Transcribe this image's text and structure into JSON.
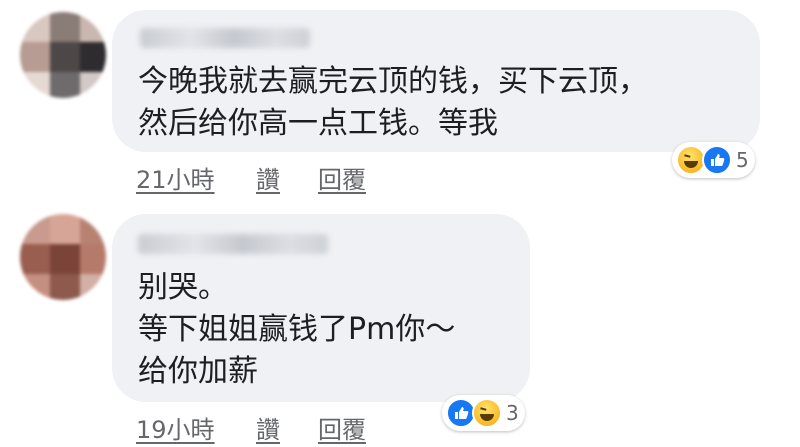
{
  "comments": [
    {
      "lines": [
        "今晚我就去赢完云顶的钱，买下云顶，",
        "然后给你高一点工钱。等我"
      ],
      "time": "21小時",
      "like_label": "讚",
      "reply_label": "回覆",
      "reactions": [
        "haha",
        "like"
      ],
      "reaction_count": "5"
    },
    {
      "lines": [
        "别哭。",
        "等下姐姐赢钱了Pm你～",
        "给你加薪"
      ],
      "time": "19小時",
      "like_label": "讚",
      "reply_label": "回覆",
      "reactions": [
        "like",
        "haha"
      ],
      "reaction_count": "3"
    }
  ],
  "colors": {
    "bubble": "#f0f1f4",
    "text": "#1c1e21",
    "meta": "#65676b",
    "like_blue": "#1877f2",
    "haha_yellow": "#f7b928"
  }
}
